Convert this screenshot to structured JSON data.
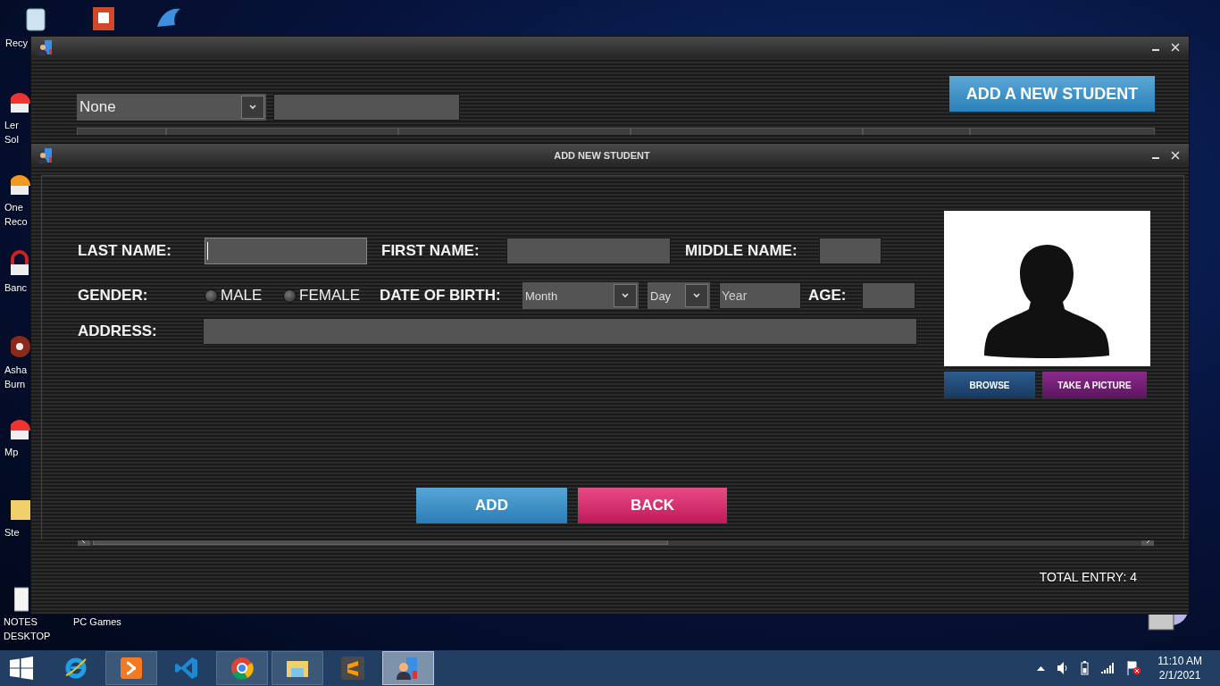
{
  "desktop_icons": [
    {
      "kind": "recycle",
      "lines": [
        "Recy"
      ]
    },
    {
      "kind": "slides"
    },
    {
      "kind": "dolphin"
    },
    {
      "kind": "red",
      "lines": [
        "Ler",
        "Sol"
      ]
    },
    {
      "kind": "orange",
      "lines": [
        "One",
        "Reco"
      ]
    },
    {
      "kind": "lock",
      "lines": [
        "Banc"
      ]
    },
    {
      "kind": "disc",
      "lines": [
        "Asha",
        "Burn"
      ]
    },
    {
      "kind": "red",
      "lines": [
        "Mp"
      ]
    },
    {
      "kind": "folder",
      "lines": [
        "Ste"
      ]
    },
    {
      "kind": "notes",
      "lines": [
        "NOTES",
        "DESKTOP"
      ]
    },
    {
      "kind": "none",
      "lines": [
        "PC Games"
      ]
    }
  ],
  "main_window": {
    "filter": {
      "value": "None"
    },
    "add_button": "ADD A NEW STUDENT",
    "status": "TOTAL ENTRY: 4"
  },
  "dialog": {
    "title": "ADD NEW STUDENT",
    "fields": [
      {
        "kind": "text",
        "label": "LAST NAME:",
        "focused": true
      },
      {
        "kind": "text",
        "label": "FIRST NAME:",
        "focused": false
      },
      {
        "kind": "text",
        "label": "MIDDLE NAME:",
        "focused": false
      },
      {
        "kind": "radio",
        "label": "GENDER:",
        "options": [
          {
            "text": "MALE",
            "selected": false
          },
          {
            "text": "FEMALE",
            "selected": false
          }
        ]
      },
      {
        "kind": "date",
        "label": "DATE OF BIRTH:",
        "month": "Month",
        "day": "Day",
        "year": "Year"
      },
      {
        "kind": "text",
        "label": "AGE:",
        "focused": false
      },
      {
        "kind": "text",
        "label": "ADDRESS:",
        "focused": false
      }
    ],
    "photo_buttons": [
      "BROWSE",
      "TAKE A PICTURE"
    ],
    "buttons": [
      "ADD",
      "BACK"
    ]
  },
  "taskbar": {
    "apps": [
      {
        "kind": "ie",
        "running": false,
        "active": false
      },
      {
        "kind": "xampp",
        "running": true,
        "active": false
      },
      {
        "kind": "vscode",
        "running": false,
        "active": false
      },
      {
        "kind": "chrome",
        "running": true,
        "active": false
      },
      {
        "kind": "explorer",
        "running": true,
        "active": false
      },
      {
        "kind": "sublime",
        "running": false,
        "active": false
      },
      {
        "kind": "student",
        "running": true,
        "active": true
      }
    ],
    "time": "11:10 AM",
    "date": "2/1/2021"
  }
}
